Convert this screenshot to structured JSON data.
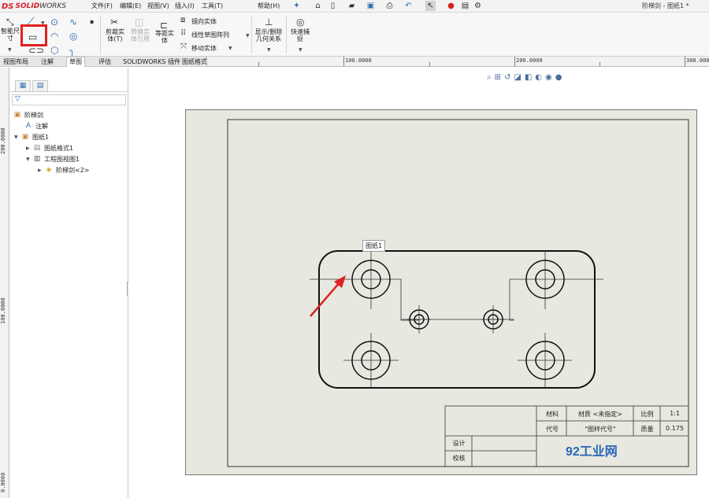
{
  "app": {
    "logo_ds": "DS",
    "logo_brand": "SOLID",
    "logo_brand2": "WORKS",
    "window_title": "阶梯剑 - 图纸1 *"
  },
  "menu": [
    "文件(F)",
    "编辑(E)",
    "视图(V)",
    "插入(I)",
    "工具(T)",
    "帮助(H)"
  ],
  "ribbon": {
    "smart_dim": "智能尺寸",
    "trim": "剪裁实体(T)",
    "convert": "转换实体引用",
    "offset": "等距实体",
    "mirror": "镜向实体",
    "linear_pattern": "线性草图阵列",
    "move": "移动实体",
    "display_relations": "显示/删除几何关系",
    "quick_snap": "快速捕捉"
  },
  "tabs": [
    {
      "label": "视图布局",
      "active": false
    },
    {
      "label": "注解",
      "active": false
    },
    {
      "label": "草图",
      "active": true
    },
    {
      "label": "评估",
      "active": false
    },
    {
      "label": "SOLIDWORKS 插件",
      "active": false
    },
    {
      "label": "图纸格式",
      "active": false
    }
  ],
  "ruler": {
    "top": [
      "100.0000",
      "200.0000",
      "300.0000"
    ],
    "left": [
      "200.0000",
      "100.0000",
      "0.0000"
    ]
  },
  "tree": {
    "root": "阶梯剑",
    "annotations": "注解",
    "sheet": "图纸1",
    "sheet_format": "图纸格式1",
    "drawing_view": "工程图视图1",
    "part": "阶梯剑<2>"
  },
  "sheet_tooltip": "图纸1",
  "title_block": {
    "material_label": "材料",
    "material_value": "材质 <未指定>",
    "scale_label": "比例",
    "scale_value": "1:1",
    "code_label": "代号",
    "code_value": "\"图样代号\"",
    "mass_label": "质量",
    "mass_value": "0.175",
    "design_label": "设计",
    "check_label": "校核",
    "watermark": "92工业网"
  },
  "colors": {
    "accent_red": "#e02020",
    "sheet_bg": "#e8e8e0",
    "brand_red": "#d4202a",
    "watermark_blue": "#2a66b8"
  }
}
